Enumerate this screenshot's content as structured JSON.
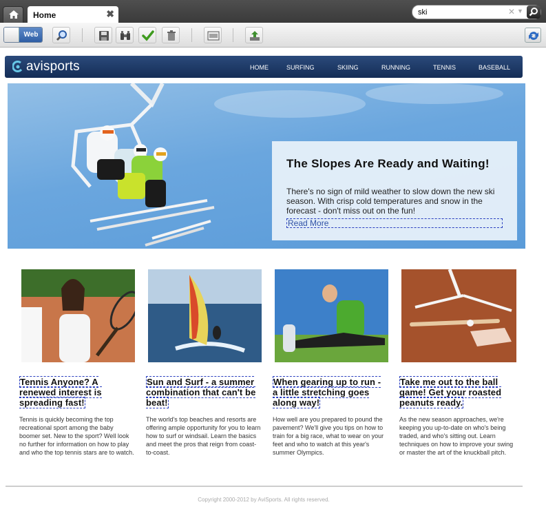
{
  "browser": {
    "tab_title": "Home",
    "search_query": "ski"
  },
  "toolbar": {
    "web_toggle_label": "Web"
  },
  "site": {
    "brand": "avisports",
    "nav": [
      "HOME",
      "SURFING",
      "SKIING",
      "RUNNING",
      "TENNIS",
      "BASEBALL"
    ]
  },
  "hero": {
    "title": "The Slopes Are Ready and Waiting!",
    "text": "There's no sign of mild weather to slow down the new ski season.  With crisp cold temperatures and snow in the forecast - don't miss out on the fun!",
    "link": "Read More"
  },
  "articles": [
    {
      "title": "Tennis Anyone? A renewed interest is spreading fast!",
      "text": "Tennis is quickly becoming the top recreational sport among the baby boomer set. New to the sport? Well look no further for information on how to play and who the top tennis stars are to watch."
    },
    {
      "title": "Sun and Surf - a summer combination that can't be beat!",
      "text": "The world's top beaches and resorts are offering ample opportunity for you to learn how to surf or windsail.  Learn the basics and meet the pros that reign from coast-to-coast."
    },
    {
      "title": "When gearing up to run - a little stretching goes along way!",
      "text": "How well are you prepared to pound the pavement? We'll give you tips on how to train for a big race, what to wear on your feet and who to watch at this year's summer Olympics."
    },
    {
      "title": "Take me out to the ball game! Get your roasted peanuts ready.",
      "text": "As the new season approaches, we're keeping you up-to-date on who's being traded, and who's sitting out. Learn techniques on how to improve your swing or master the art of the knuckball pitch."
    }
  ],
  "footer": {
    "copyright": "Copyright 2000-2012 by AviSports. All rights reserved."
  }
}
